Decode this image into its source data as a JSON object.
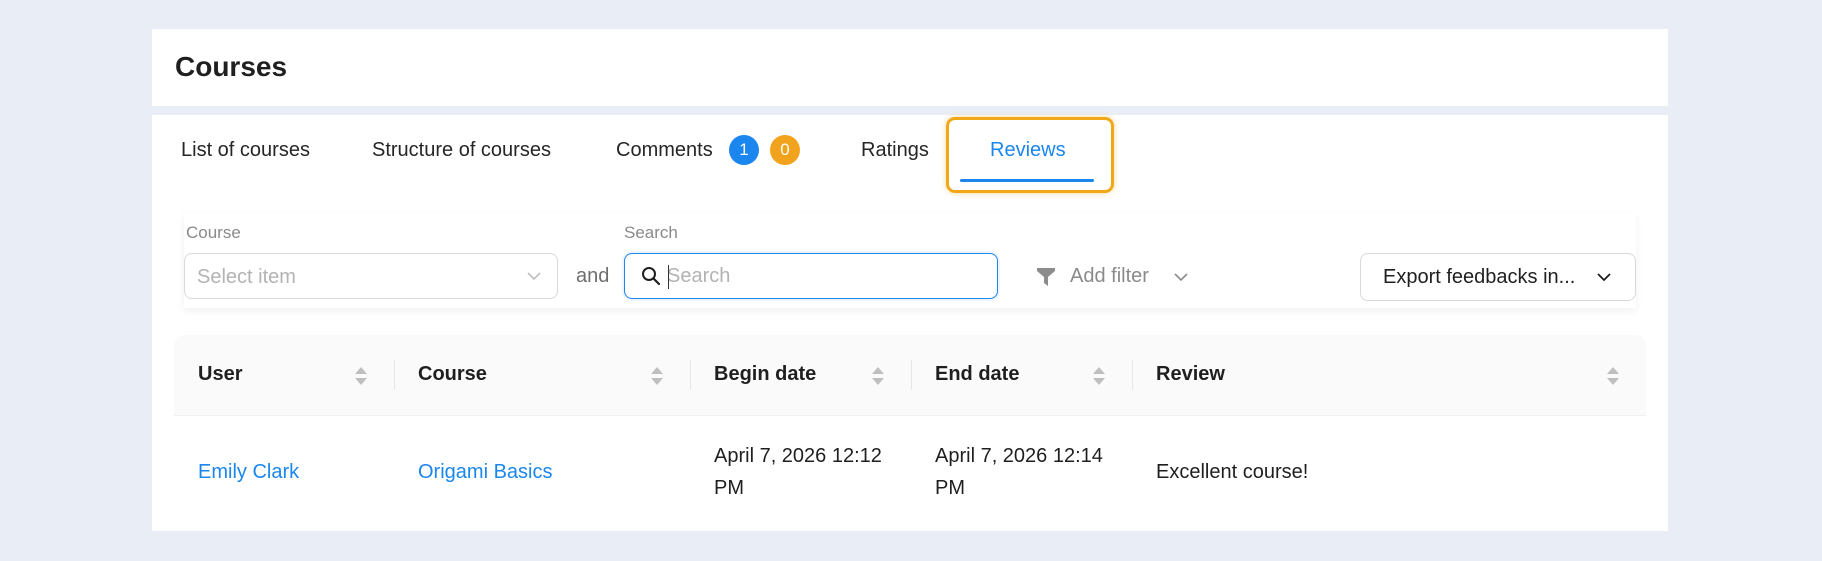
{
  "header": {
    "title": "Courses"
  },
  "tabs": [
    {
      "label": "List of courses",
      "active": false
    },
    {
      "label": "Structure of courses",
      "active": false
    },
    {
      "label": "Comments",
      "active": false,
      "badges": [
        "1",
        "0"
      ]
    },
    {
      "label": "Ratings",
      "active": false
    },
    {
      "label": "Reviews",
      "active": true
    }
  ],
  "filters": {
    "course_label": "Course",
    "course_placeholder": "Select item",
    "conjunction": "and",
    "search_label": "Search",
    "search_placeholder": "Search",
    "search_value": "",
    "add_filter_label": "Add filter",
    "export_label": "Export feedbacks in..."
  },
  "table": {
    "columns": [
      "User",
      "Course",
      "Begin date",
      "End date",
      "Review"
    ],
    "rows": [
      {
        "user": "Emily Clark",
        "course": "Origami Basics",
        "begin_date_line1": "April 7, 2026 12:12",
        "begin_date_line2": "PM",
        "end_date_line1": "April 7, 2026 12:14",
        "end_date_line2": "PM",
        "review": "Excellent course!"
      }
    ]
  },
  "colors": {
    "accent": "#1a86ee",
    "badge_orange": "#f2a31e",
    "highlight": "#f0a818",
    "background": "#e9eef6"
  },
  "icons": {
    "search": "search-icon",
    "funnel": "funnel-icon",
    "chevron": "chevron-down-icon",
    "sort": "sort-icon"
  }
}
